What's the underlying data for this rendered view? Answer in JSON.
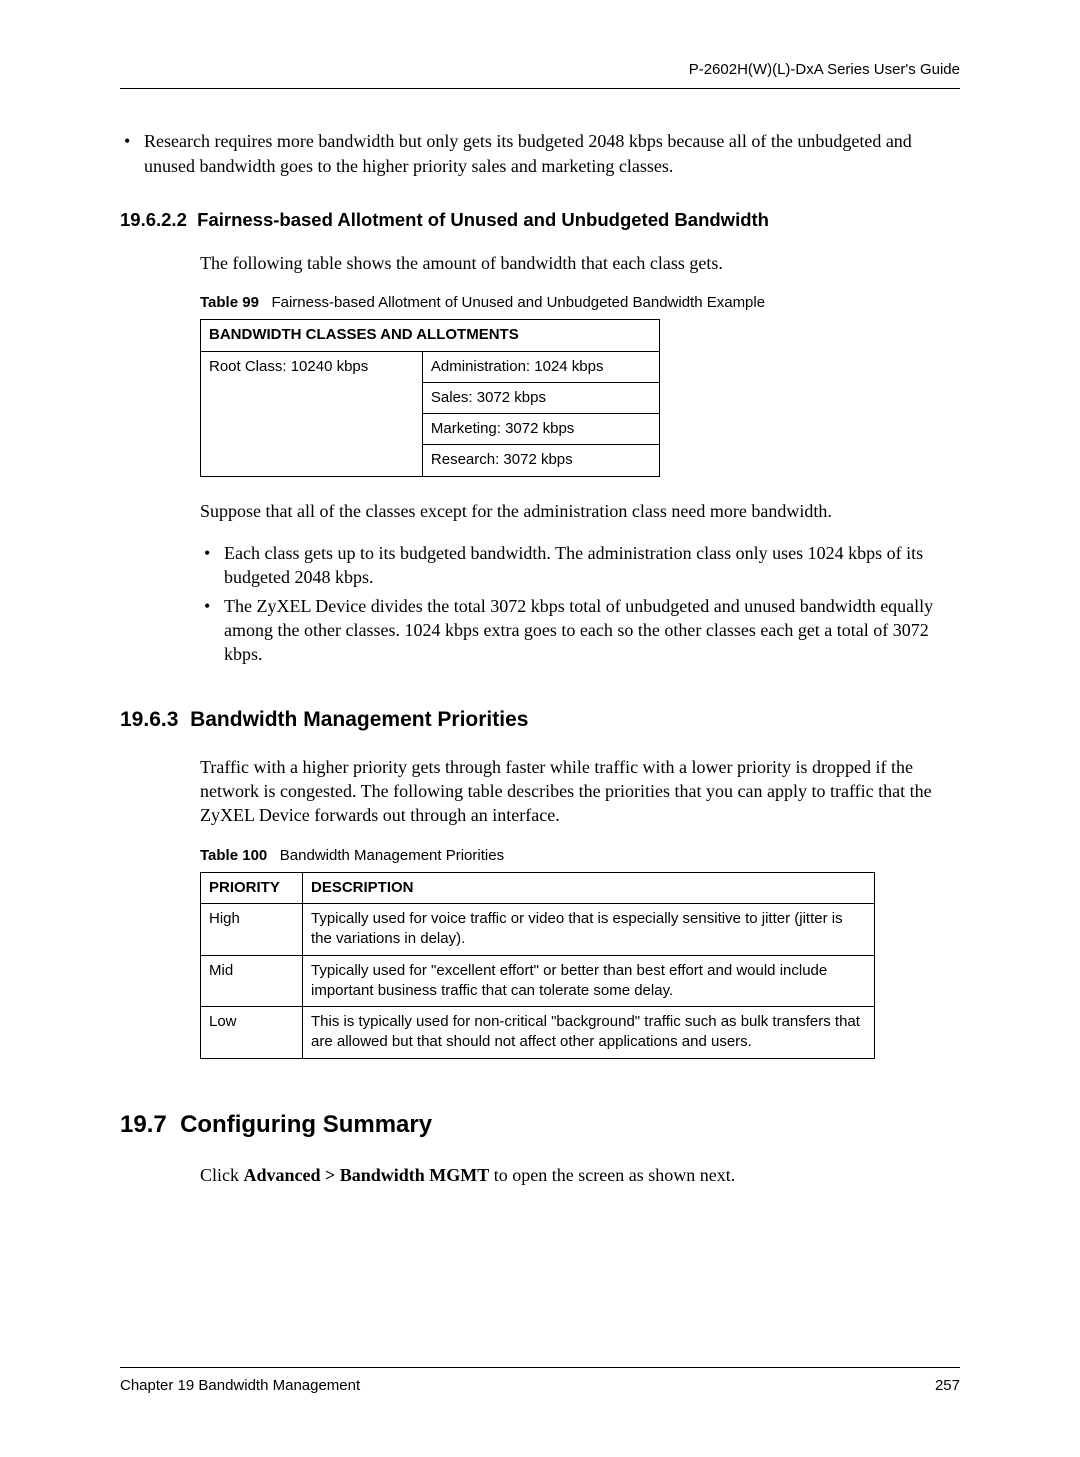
{
  "header": {
    "guide_title": "P-2602H(W)(L)-DxA Series User's Guide"
  },
  "intro_bullet": "Research requires more bandwidth but only gets its budgeted 2048 kbps because all of the unbudgeted and unused bandwidth goes to the higher priority sales and marketing classes.",
  "sec_19_6_2_2": {
    "number": "19.6.2.2",
    "title": "Fairness-based Allotment of Unused and Unbudgeted Bandwidth",
    "intro": "The following table shows the amount of bandwidth that each class gets.",
    "table_caption_label": "Table 99",
    "table_caption": "Fairness-based Allotment of Unused and Unbudgeted Bandwidth Example",
    "table_header": "BANDWIDTH CLASSES AND ALLOTMENTS",
    "root_cell": "Root Class: 10240 kbps",
    "rows": [
      "Administration: 1024 kbps",
      "Sales: 3072 kbps",
      "Marketing: 3072 kbps",
      "Research: 3072 kbps"
    ],
    "suppose": "Suppose that all of the classes except for the administration class need more bandwidth.",
    "bullets": [
      "Each class gets up to its budgeted bandwidth. The administration class only uses 1024 kbps of its budgeted 2048 kbps.",
      "The ZyXEL Device divides the total 3072 kbps total of unbudgeted and unused bandwidth equally among the other classes. 1024 kbps extra goes to each so the other classes each get a total of 3072 kbps."
    ]
  },
  "sec_19_6_3": {
    "number": "19.6.3",
    "title": "Bandwidth Management Priorities",
    "intro": "Traffic with a higher priority gets through faster while traffic with a lower priority is dropped if the network is congested. The following table describes the priorities that you can apply to traffic that the ZyXEL Device forwards out through an interface.",
    "table_caption_label": "Table 100",
    "table_caption": "Bandwidth Management Priorities",
    "col1": "PRIORITY",
    "col2": "DESCRIPTION",
    "rows": [
      {
        "p": "High",
        "d": "Typically used for voice traffic or video that is especially sensitive to jitter (jitter is the variations in delay)."
      },
      {
        "p": "Mid",
        "d": "Typically used for \"excellent effort\" or better than best effort and would include important business traffic that can tolerate some delay."
      },
      {
        "p": "Low",
        "d": "This is typically used for non-critical \"background\" traffic such as bulk transfers that are allowed but that should not affect other applications and users."
      }
    ]
  },
  "sec_19_7": {
    "number": "19.7",
    "title": "Configuring Summary",
    "click_prefix": "Click ",
    "click_bold": "Advanced > Bandwidth MGMT",
    "click_suffix": " to open the screen as shown next."
  },
  "footer": {
    "chapter": "Chapter 19 Bandwidth Management",
    "page": "257"
  }
}
